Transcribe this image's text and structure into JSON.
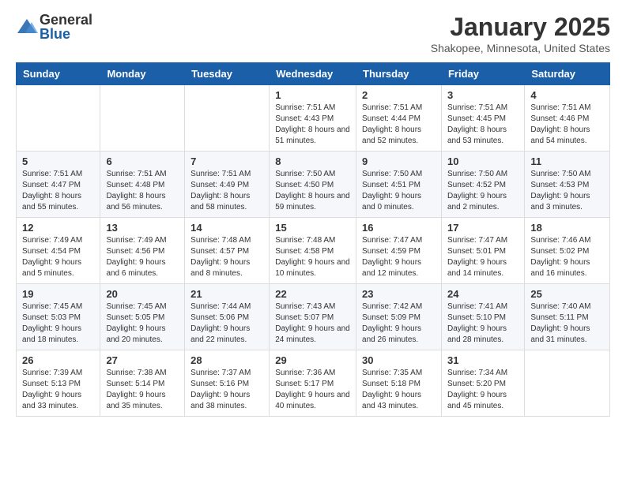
{
  "logo": {
    "general": "General",
    "blue": "Blue"
  },
  "header": {
    "month": "January 2025",
    "location": "Shakopee, Minnesota, United States"
  },
  "days": [
    "Sunday",
    "Monday",
    "Tuesday",
    "Wednesday",
    "Thursday",
    "Friday",
    "Saturday"
  ],
  "weeks": [
    [
      {
        "day": "",
        "info": ""
      },
      {
        "day": "",
        "info": ""
      },
      {
        "day": "",
        "info": ""
      },
      {
        "day": "1",
        "info": "Sunrise: 7:51 AM\nSunset: 4:43 PM\nDaylight: 8 hours and 51 minutes."
      },
      {
        "day": "2",
        "info": "Sunrise: 7:51 AM\nSunset: 4:44 PM\nDaylight: 8 hours and 52 minutes."
      },
      {
        "day": "3",
        "info": "Sunrise: 7:51 AM\nSunset: 4:45 PM\nDaylight: 8 hours and 53 minutes."
      },
      {
        "day": "4",
        "info": "Sunrise: 7:51 AM\nSunset: 4:46 PM\nDaylight: 8 hours and 54 minutes."
      }
    ],
    [
      {
        "day": "5",
        "info": "Sunrise: 7:51 AM\nSunset: 4:47 PM\nDaylight: 8 hours and 55 minutes."
      },
      {
        "day": "6",
        "info": "Sunrise: 7:51 AM\nSunset: 4:48 PM\nDaylight: 8 hours and 56 minutes."
      },
      {
        "day": "7",
        "info": "Sunrise: 7:51 AM\nSunset: 4:49 PM\nDaylight: 8 hours and 58 minutes."
      },
      {
        "day": "8",
        "info": "Sunrise: 7:50 AM\nSunset: 4:50 PM\nDaylight: 8 hours and 59 minutes."
      },
      {
        "day": "9",
        "info": "Sunrise: 7:50 AM\nSunset: 4:51 PM\nDaylight: 9 hours and 0 minutes."
      },
      {
        "day": "10",
        "info": "Sunrise: 7:50 AM\nSunset: 4:52 PM\nDaylight: 9 hours and 2 minutes."
      },
      {
        "day": "11",
        "info": "Sunrise: 7:50 AM\nSunset: 4:53 PM\nDaylight: 9 hours and 3 minutes."
      }
    ],
    [
      {
        "day": "12",
        "info": "Sunrise: 7:49 AM\nSunset: 4:54 PM\nDaylight: 9 hours and 5 minutes."
      },
      {
        "day": "13",
        "info": "Sunrise: 7:49 AM\nSunset: 4:56 PM\nDaylight: 9 hours and 6 minutes."
      },
      {
        "day": "14",
        "info": "Sunrise: 7:48 AM\nSunset: 4:57 PM\nDaylight: 9 hours and 8 minutes."
      },
      {
        "day": "15",
        "info": "Sunrise: 7:48 AM\nSunset: 4:58 PM\nDaylight: 9 hours and 10 minutes."
      },
      {
        "day": "16",
        "info": "Sunrise: 7:47 AM\nSunset: 4:59 PM\nDaylight: 9 hours and 12 minutes."
      },
      {
        "day": "17",
        "info": "Sunrise: 7:47 AM\nSunset: 5:01 PM\nDaylight: 9 hours and 14 minutes."
      },
      {
        "day": "18",
        "info": "Sunrise: 7:46 AM\nSunset: 5:02 PM\nDaylight: 9 hours and 16 minutes."
      }
    ],
    [
      {
        "day": "19",
        "info": "Sunrise: 7:45 AM\nSunset: 5:03 PM\nDaylight: 9 hours and 18 minutes."
      },
      {
        "day": "20",
        "info": "Sunrise: 7:45 AM\nSunset: 5:05 PM\nDaylight: 9 hours and 20 minutes."
      },
      {
        "day": "21",
        "info": "Sunrise: 7:44 AM\nSunset: 5:06 PM\nDaylight: 9 hours and 22 minutes."
      },
      {
        "day": "22",
        "info": "Sunrise: 7:43 AM\nSunset: 5:07 PM\nDaylight: 9 hours and 24 minutes."
      },
      {
        "day": "23",
        "info": "Sunrise: 7:42 AM\nSunset: 5:09 PM\nDaylight: 9 hours and 26 minutes."
      },
      {
        "day": "24",
        "info": "Sunrise: 7:41 AM\nSunset: 5:10 PM\nDaylight: 9 hours and 28 minutes."
      },
      {
        "day": "25",
        "info": "Sunrise: 7:40 AM\nSunset: 5:11 PM\nDaylight: 9 hours and 31 minutes."
      }
    ],
    [
      {
        "day": "26",
        "info": "Sunrise: 7:39 AM\nSunset: 5:13 PM\nDaylight: 9 hours and 33 minutes."
      },
      {
        "day": "27",
        "info": "Sunrise: 7:38 AM\nSunset: 5:14 PM\nDaylight: 9 hours and 35 minutes."
      },
      {
        "day": "28",
        "info": "Sunrise: 7:37 AM\nSunset: 5:16 PM\nDaylight: 9 hours and 38 minutes."
      },
      {
        "day": "29",
        "info": "Sunrise: 7:36 AM\nSunset: 5:17 PM\nDaylight: 9 hours and 40 minutes."
      },
      {
        "day": "30",
        "info": "Sunrise: 7:35 AM\nSunset: 5:18 PM\nDaylight: 9 hours and 43 minutes."
      },
      {
        "day": "31",
        "info": "Sunrise: 7:34 AM\nSunset: 5:20 PM\nDaylight: 9 hours and 45 minutes."
      },
      {
        "day": "",
        "info": ""
      }
    ]
  ]
}
